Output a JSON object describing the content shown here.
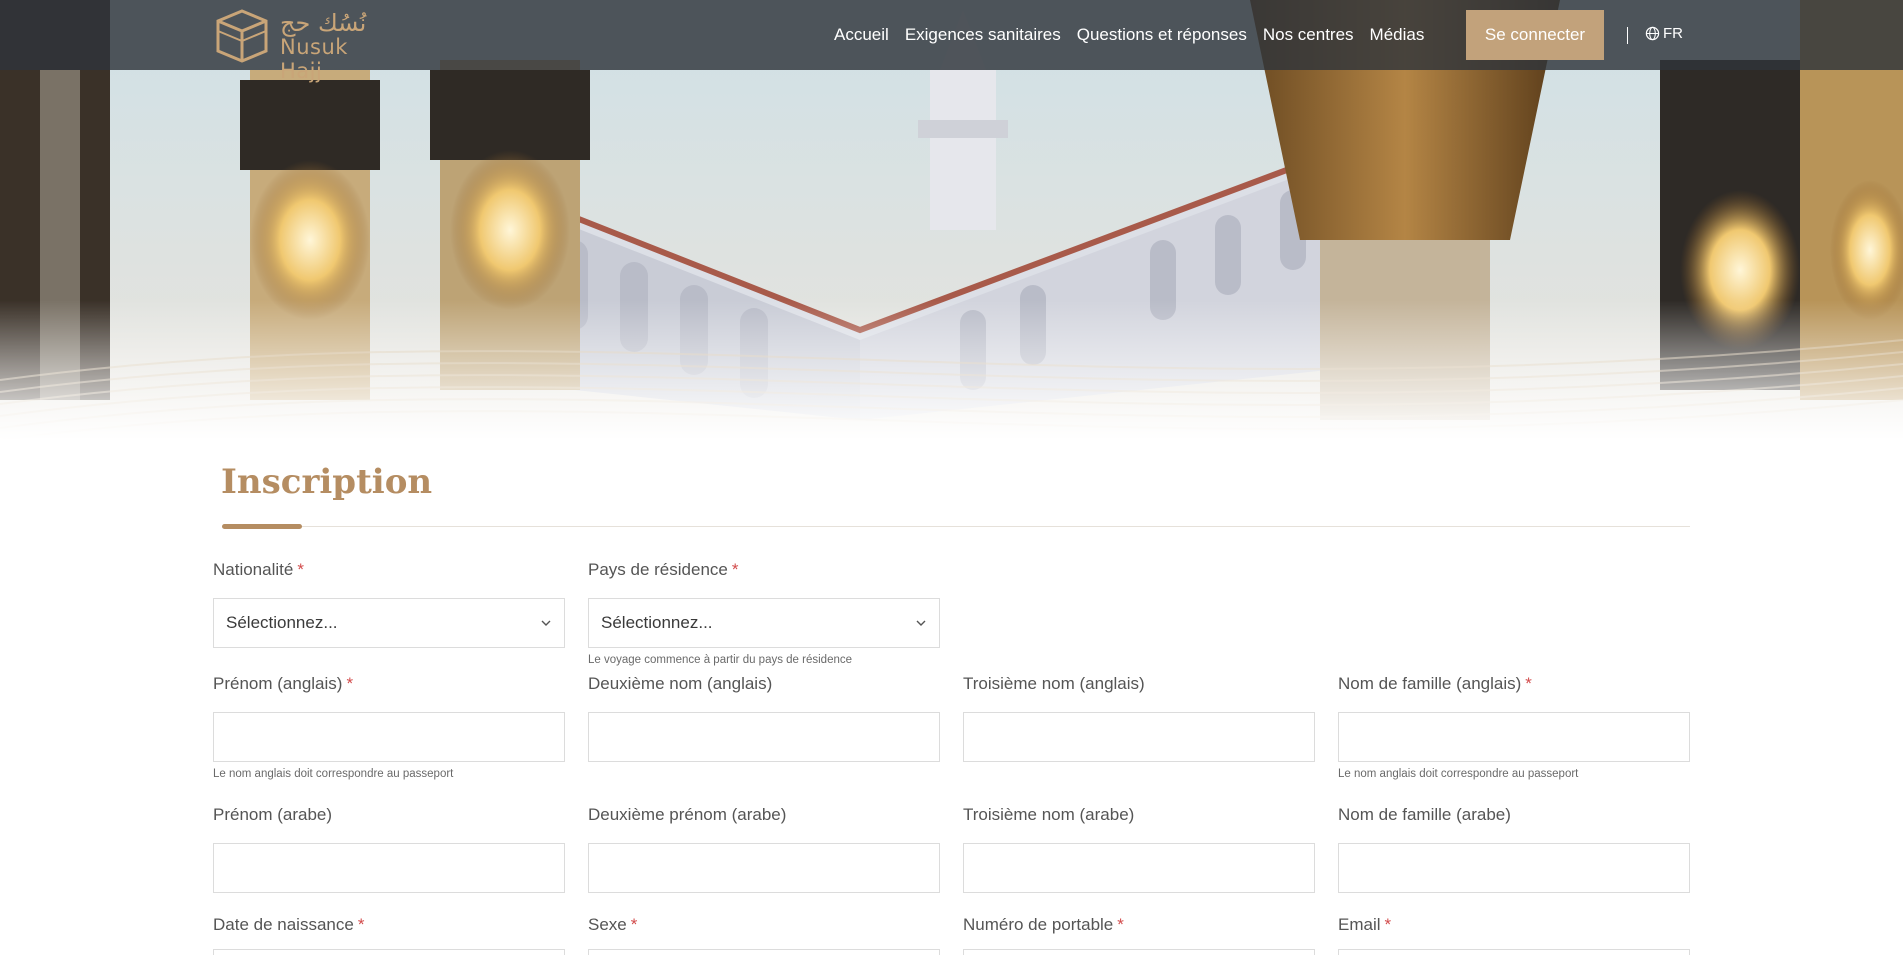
{
  "header": {
    "logo": {
      "arabic": "نُسُك حج",
      "english": "Nusuk Hajj"
    },
    "nav": [
      {
        "label": "Accueil"
      },
      {
        "label": "Exigences sanitaires"
      },
      {
        "label": "Questions et réponses"
      },
      {
        "label": "Nos centres"
      },
      {
        "label": "Médias"
      }
    ],
    "login_label": "Se connecter",
    "language": {
      "label": "FR",
      "icon": "globe-icon"
    }
  },
  "page": {
    "title": "Inscription"
  },
  "form": {
    "required_marker": "*",
    "nationality": {
      "label": "Nationalité",
      "value": "Sélectionnez...",
      "required": true
    },
    "residence": {
      "label": "Pays de résidence",
      "value": "Sélectionnez...",
      "required": true,
      "hint": "Le voyage commence à partir du pays de résidence"
    },
    "first_name_en": {
      "label": "Prénom (anglais)",
      "required": true,
      "hint": "Le nom anglais doit correspondre au passeport"
    },
    "second_name_en": {
      "label": "Deuxième nom (anglais)"
    },
    "third_name_en": {
      "label": "Troisième nom (anglais)"
    },
    "last_name_en": {
      "label": "Nom de famille (anglais)",
      "required": true,
      "hint": "Le nom anglais doit correspondre au passeport"
    },
    "first_name_ar": {
      "label": "Prénom (arabe)"
    },
    "second_name_ar": {
      "label": "Deuxième prénom (arabe)"
    },
    "third_name_ar": {
      "label": "Troisième nom (arabe)"
    },
    "last_name_ar": {
      "label": "Nom de famille (arabe)"
    },
    "birth_date": {
      "label": "Date de naissance",
      "required": true
    },
    "gender": {
      "label": "Sexe",
      "required": true
    },
    "mobile": {
      "label": "Numéro de portable",
      "required": true
    },
    "email": {
      "label": "Email",
      "required": true
    }
  },
  "colors": {
    "accent": "#c2a27b",
    "title": "#b58d62",
    "required": "#d24b4b",
    "navbar": "#30343a"
  }
}
